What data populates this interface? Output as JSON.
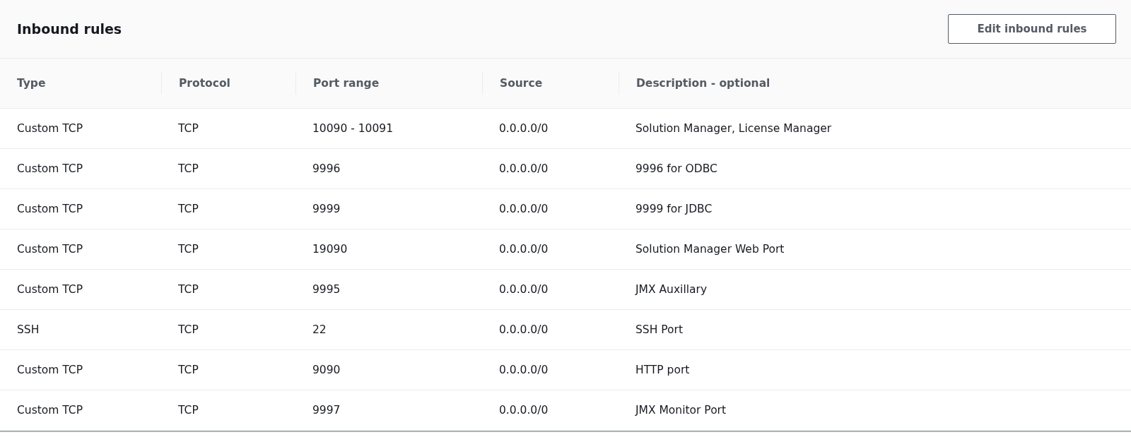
{
  "panel": {
    "title": "Inbound rules",
    "button": "Edit inbound rules"
  },
  "table": {
    "columns": [
      "Type",
      "Protocol",
      "Port range",
      "Source",
      "Description - optional"
    ],
    "rows": [
      [
        "Custom TCP",
        "TCP",
        "10090 - 10091",
        "0.0.0.0/0",
        "Solution Manager, License Manager"
      ],
      [
        "Custom TCP",
        "TCP",
        "9996",
        "0.0.0.0/0",
        "9996 for ODBC"
      ],
      [
        "Custom TCP",
        "TCP",
        "9999",
        "0.0.0.0/0",
        "9999 for JDBC"
      ],
      [
        "Custom TCP",
        "TCP",
        "19090",
        "0.0.0.0/0",
        "Solution Manager Web Port"
      ],
      [
        "Custom TCP",
        "TCP",
        "9995",
        "0.0.0.0/0",
        "JMX Auxillary"
      ],
      [
        "SSH",
        "TCP",
        "22",
        "0.0.0.0/0",
        "SSH Port"
      ],
      [
        "Custom TCP",
        "TCP",
        "9090",
        "0.0.0.0/0",
        "HTTP port"
      ],
      [
        "Custom TCP",
        "TCP",
        "9997",
        "0.0.0.0/0",
        "JMX Monitor Port"
      ]
    ]
  }
}
